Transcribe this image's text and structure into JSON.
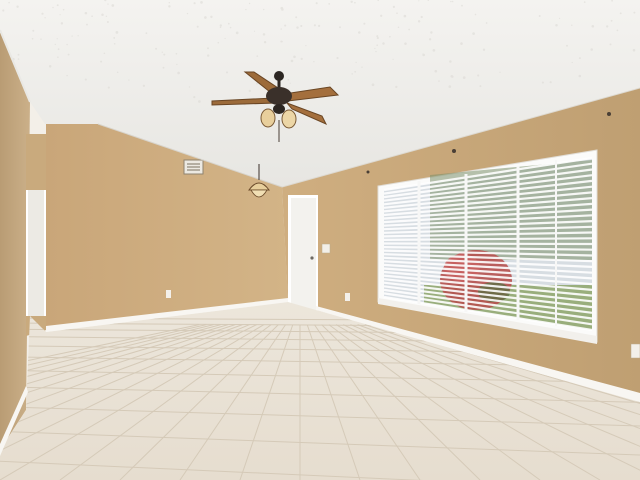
{
  "scene": {
    "description_free": true,
    "palette": {
      "ceiling": "#f3f2ef",
      "ceiling_shadow": "#e4e3df",
      "wall_left": "#c9b08a",
      "wall_back": "#caa97c",
      "wall_right": "#c6a679",
      "wall_shadow": "#b89a70",
      "floor_tile": "#e9e2d6",
      "floor_grout": "#d7cdbd",
      "baseboard": "#f7f5f0",
      "door": "#f6f5f1",
      "window_frame": "#fbfbfa",
      "blind": "#f2f4f6",
      "fan_blade": "#9a6b3c",
      "fan_body": "#2d2622",
      "foliage_red": "#b34a4a",
      "sky": "#cfd8df",
      "lawn": "#7ea25a"
    }
  }
}
